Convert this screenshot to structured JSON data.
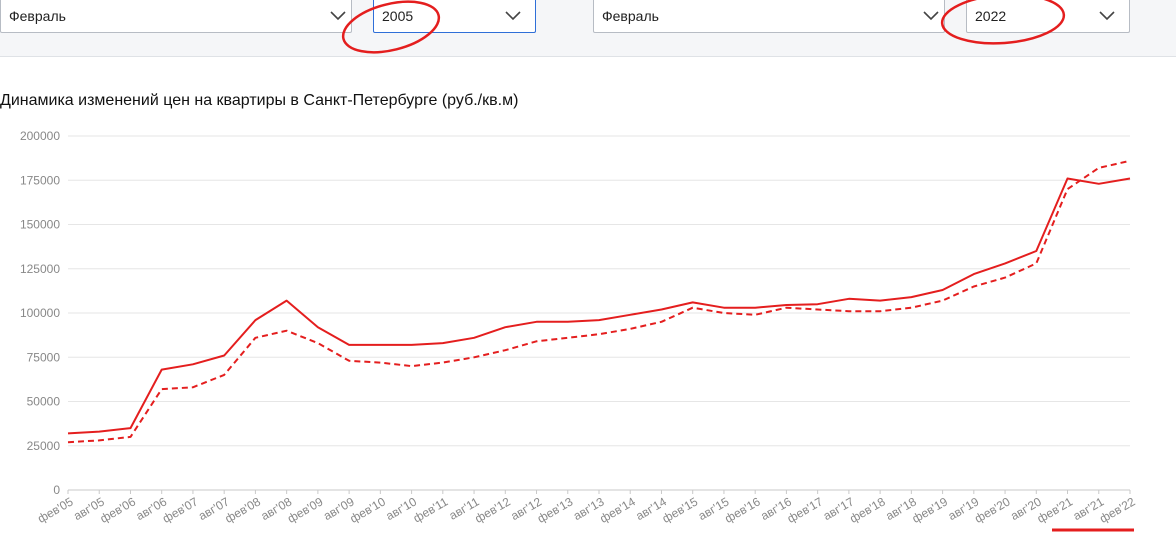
{
  "filters": {
    "from_month": "Февраль",
    "from_year": "2005",
    "to_month": "Февраль",
    "to_year": "2022"
  },
  "annotation_color": "#e41e1e",
  "chart_data": {
    "type": "line",
    "title": "Динамика изменений цен на квартиры в Санкт-Петербурге (руб./кв.м)",
    "xlabel": "",
    "ylabel": "",
    "ylim": [
      0,
      200000
    ],
    "yticks": [
      0,
      25000,
      50000,
      75000,
      100000,
      125000,
      150000,
      175000,
      200000
    ],
    "grid": true,
    "x": [
      "фев'05",
      "авг'05",
      "фев'06",
      "авг'06",
      "фев'07",
      "авг'07",
      "фев'08",
      "авг'08",
      "фев'09",
      "авг'09",
      "фев'10",
      "авг'10",
      "фев'11",
      "авг'11",
      "фев'12",
      "авг'12",
      "фев'13",
      "авг'13",
      "фев'14",
      "авг'14",
      "фев'15",
      "авг'15",
      "фев'16",
      "авг'16",
      "фев'17",
      "авг'17",
      "фев'18",
      "авг'18",
      "фев'19",
      "авг'19",
      "фев'20",
      "авг'20",
      "фев'21",
      "авг'21",
      "фев'22"
    ],
    "series": [
      {
        "style": "solid",
        "color": "#e41e1e",
        "values": [
          32000,
          33000,
          35000,
          68000,
          71000,
          76000,
          96000,
          107000,
          92000,
          82000,
          82000,
          82000,
          83000,
          86000,
          92000,
          95000,
          95000,
          96000,
          99000,
          102000,
          106000,
          103000,
          103000,
          104500,
          105000,
          108000,
          107000,
          109000,
          113000,
          122000,
          128000,
          135000,
          176000,
          173000,
          176000
        ]
      },
      {
        "style": "dashed",
        "color": "#e41e1e",
        "values": [
          27000,
          28000,
          30000,
          57000,
          58000,
          65000,
          86000,
          90000,
          83000,
          73000,
          72000,
          70000,
          72000,
          75000,
          79000,
          84000,
          86000,
          88000,
          91000,
          95000,
          103000,
          100000,
          99000,
          103000,
          102000,
          101000,
          101000,
          103000,
          107000,
          115000,
          120000,
          128000,
          170000,
          182000,
          186000
        ]
      }
    ]
  }
}
